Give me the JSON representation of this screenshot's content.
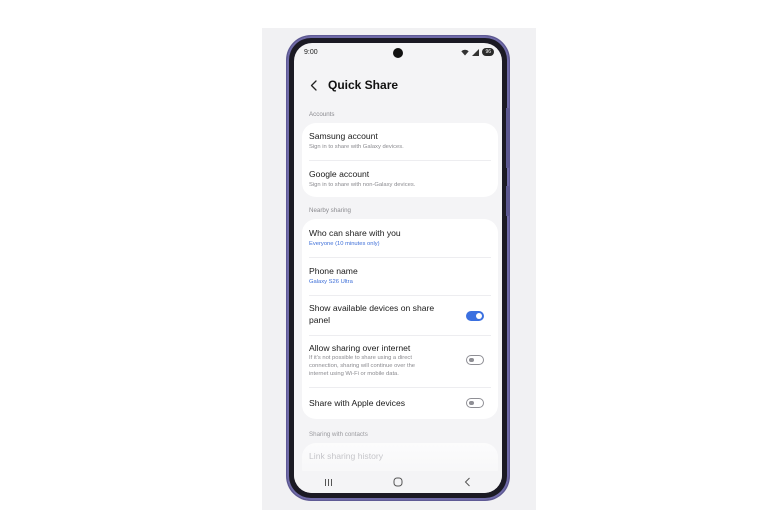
{
  "status_bar": {
    "time": "9:00",
    "battery": "96"
  },
  "header": {
    "title": "Quick Share"
  },
  "accounts": {
    "label": "Accounts",
    "items": [
      {
        "title": "Samsung account",
        "subtitle": "Sign in to share with Galaxy devices."
      },
      {
        "title": "Google account",
        "subtitle": "Sign in to share with non-Galaxy devices."
      }
    ]
  },
  "nearby": {
    "label": "Nearby sharing",
    "who": {
      "title": "Who can share with you",
      "subtitle": "Everyone (10 minutes only)"
    },
    "phone": {
      "title": "Phone name",
      "subtitle": "Galaxy S26 Ultra"
    },
    "show_devices": {
      "title_1": "Show available devices on share",
      "title_2": "panel",
      "enabled": true
    },
    "internet": {
      "title": "Allow sharing over internet",
      "desc_1": "If it's not possible to share using a direct",
      "desc_2": "connection, sharing will continue over the",
      "desc_3": "internet using Wi-Fi or mobile data.",
      "enabled": false
    },
    "apple": {
      "title": "Share with Apple devices",
      "enabled": false
    }
  },
  "contacts": {
    "label": "Sharing with contacts",
    "history": "Link sharing history"
  },
  "colors": {
    "accent": "#3b70e0",
    "frame": "#6f6aa8",
    "background": "#f4f4f6",
    "card": "#ffffff"
  }
}
